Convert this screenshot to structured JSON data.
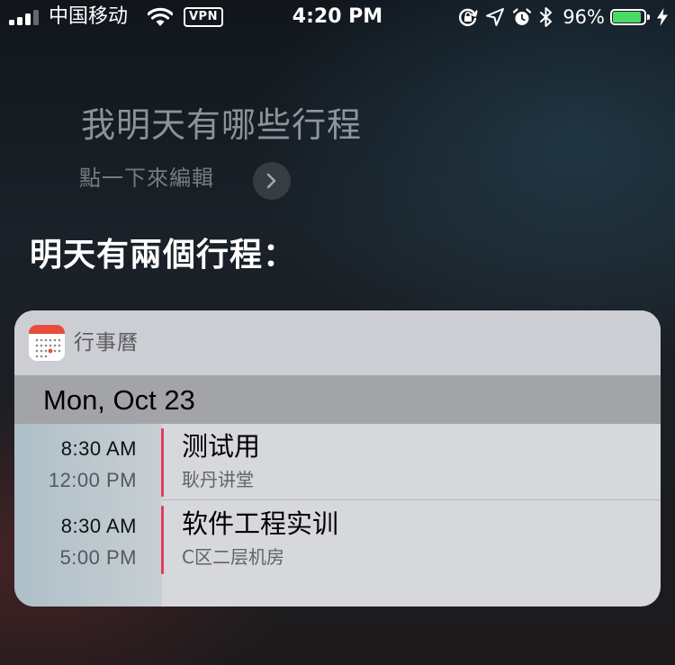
{
  "status_bar": {
    "carrier": "中国移动",
    "vpn_label": "VPN",
    "time": "4:20 PM",
    "battery_percent": "96%",
    "battery_level": 0.96,
    "signal_bars": 3,
    "signal_bars_total": 4,
    "icons": [
      "signal-icon",
      "wifi-icon",
      "vpn-icon",
      "orientation-lock-icon",
      "location-arrow-icon",
      "alarm-icon",
      "bluetooth-icon",
      "battery-icon",
      "charging-bolt-icon"
    ],
    "battery_color": "#4cd964"
  },
  "siri": {
    "query": "我明天有哪些行程",
    "edit_hint": "點一下來編輯",
    "edit_icon": "chevron-right-icon",
    "answer": "明天有兩個行程："
  },
  "calendar_card": {
    "app_name": "行事曆",
    "app_icon": "calendar-app-icon",
    "date": "Mon, Oct 23",
    "accent_color": "#e03e5c",
    "events": [
      {
        "start": "8:30 AM",
        "end": "12:00 PM",
        "title": "测试用",
        "location": "耿丹讲堂"
      },
      {
        "start": "8:30 AM",
        "end": "5:00 PM",
        "title": "软件工程实训",
        "location": "C区二层机房"
      }
    ]
  }
}
